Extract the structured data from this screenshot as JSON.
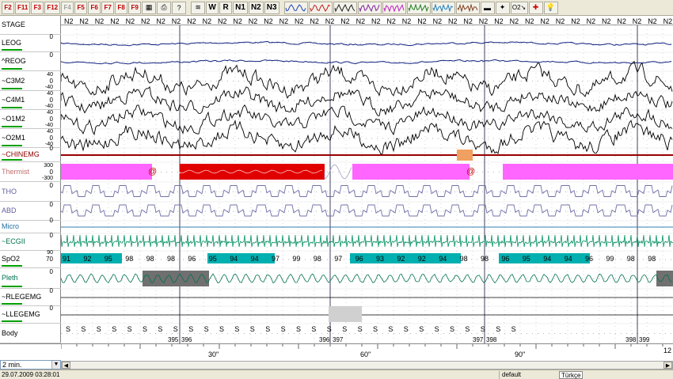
{
  "toolbar": {
    "fkeys": [
      {
        "label": "F2",
        "style": "red"
      },
      {
        "label": "F11",
        "style": "red"
      },
      {
        "label": "F3",
        "style": "red"
      },
      {
        "label": "F12",
        "style": "red"
      },
      {
        "label": "F4",
        "style": "grey"
      },
      {
        "label": "F5",
        "style": "red"
      },
      {
        "label": "F6",
        "style": "red"
      },
      {
        "label": "F7",
        "style": "red"
      },
      {
        "label": "F8",
        "style": "red"
      },
      {
        "label": "F9",
        "style": "red"
      }
    ],
    "stage_buttons": [
      "W",
      "R",
      "N1",
      "N2",
      "N3"
    ],
    "sat_label": "O2↘"
  },
  "channels": [
    {
      "name": "STAGE",
      "color": "#000000",
      "scale_top": "",
      "scale_zero": "",
      "scale_bottom": "",
      "bar": false
    },
    {
      "name": "LEOG",
      "color": "#000000",
      "scale_top": "",
      "scale_zero": "0",
      "scale_bottom": "",
      "bar": true
    },
    {
      "name": "^REOG",
      "color": "#000000",
      "scale_top": "",
      "scale_zero": "0",
      "scale_bottom": "",
      "bar": true
    },
    {
      "name": "~C3M2",
      "color": "#000000",
      "scale_top": "40",
      "scale_zero": "0",
      "scale_bottom": "-40",
      "bar": true
    },
    {
      "name": "~C4M1",
      "color": "#000000",
      "scale_top": "40",
      "scale_zero": "0",
      "scale_bottom": "-40",
      "bar": true
    },
    {
      "name": "~O1M2",
      "color": "#000000",
      "scale_top": "40",
      "scale_zero": "0",
      "scale_bottom": "-40",
      "bar": true
    },
    {
      "name": "~O2M1",
      "color": "#000000",
      "scale_top": "40",
      "scale_zero": "0",
      "scale_bottom": "-40",
      "bar": true
    },
    {
      "name": "~CHINEMG",
      "color": "#8b0000",
      "scale_top": "",
      "scale_zero": "0",
      "scale_bottom": "",
      "bar": true
    },
    {
      "name": "Thermist",
      "color": "#c07070",
      "scale_top": "300",
      "scale_zero": "0",
      "scale_bottom": "-300",
      "bar": false
    },
    {
      "name": "THO",
      "color": "#6060a0",
      "scale_top": "",
      "scale_zero": "0",
      "scale_bottom": "",
      "bar": false
    },
    {
      "name": "ABD",
      "color": "#6060a0",
      "scale_top": "",
      "scale_zero": "0",
      "scale_bottom": "",
      "bar": false
    },
    {
      "name": "Micro",
      "color": "#2070a0",
      "scale_top": "",
      "scale_zero": "0",
      "scale_bottom": "",
      "bar": false
    },
    {
      "name": "~ECGII",
      "color": "#007050",
      "scale_top": "",
      "scale_zero": "0",
      "scale_bottom": "",
      "bar": false
    },
    {
      "name": "SpO2",
      "color": "#000000",
      "scale_top": "90",
      "scale_zero": "70",
      "scale_bottom": "",
      "bar": true
    },
    {
      "name": "Pleth",
      "color": "#007050",
      "scale_top": "",
      "scale_zero": "0",
      "scale_bottom": "",
      "bar": true
    },
    {
      "name": "~RLEGEMG",
      "color": "#000000",
      "scale_top": "",
      "scale_zero": "0",
      "scale_bottom": "",
      "bar": true
    },
    {
      "name": "~LLEGEMG",
      "color": "#000000",
      "scale_top": "",
      "scale_zero": "0",
      "scale_bottom": "",
      "bar": true
    },
    {
      "name": "Body",
      "color": "#000000",
      "scale_top": "",
      "scale_zero": "",
      "scale_bottom": "",
      "bar": false
    }
  ],
  "stage_label": "N2",
  "spo2": {
    "values": [
      "91",
      "92",
      "95",
      "98",
      "98",
      "98",
      "96",
      "95",
      "94",
      "94",
      "97",
      "99",
      "98",
      "97",
      "96",
      "93",
      "92",
      "92",
      "94",
      "98",
      "98",
      "96",
      "95",
      "94",
      "94",
      "96",
      "99",
      "98",
      "98"
    ],
    "fill_color": "#00b0b0"
  },
  "body_label": "S",
  "epochs": [
    "395",
    "396",
    "396",
    "397",
    "397",
    "398",
    "398",
    "399"
  ],
  "ruler": {
    "ticks": [
      "30\"",
      "60\"",
      "90\""
    ],
    "end": "12"
  },
  "events": {
    "thermist_marker": "@",
    "apnea_color": "#e00000",
    "hypopnea_color": "#ff66ff"
  },
  "zoom": "2 min.",
  "status": {
    "datetime": "29.07.2009 03:28:01",
    "profile": "default",
    "language": "Türkçe"
  }
}
